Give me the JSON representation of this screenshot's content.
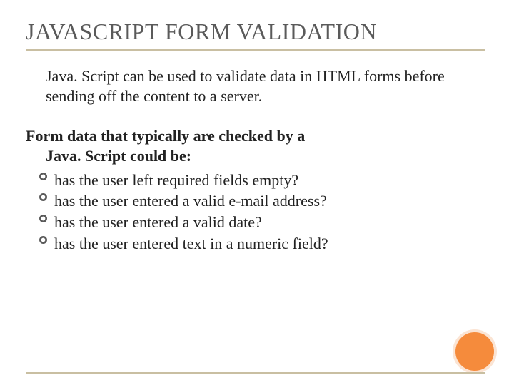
{
  "title": "JAVASCRIPT FORM VALIDATION",
  "intro": "Java. Script can be used to validate data in HTML forms before sending off the content to a server.",
  "subhead_line1": "Form data that typically are checked by a",
  "subhead_line2": "Java. Script could be:",
  "bullets": [
    "has the user left required fields empty?",
    "has the user entered a valid e-mail address?",
    "has the user entered a valid date?",
    "has the user entered text in a numeric field?"
  ],
  "colors": {
    "rule": "#c9bfa2",
    "circle_fill": "#f58b3c",
    "circle_ring": "#fbe4d3",
    "bullet_stroke": "#5a5a5a"
  }
}
